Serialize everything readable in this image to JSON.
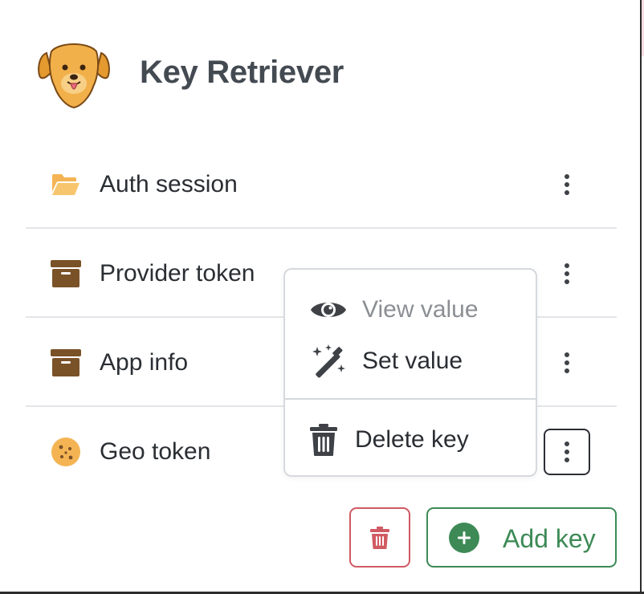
{
  "app": {
    "title": "Key Retriever",
    "logo_icon": "golden-retriever-logo"
  },
  "keys": [
    {
      "label": "Auth session",
      "icon": "folder-open-icon"
    },
    {
      "label": "Provider token",
      "icon": "archive-box-icon"
    },
    {
      "label": "App info",
      "icon": "archive-box-icon"
    },
    {
      "label": "Geo token",
      "icon": "cookie-icon"
    }
  ],
  "context_menu": {
    "view_value": "View value",
    "set_value": "Set value",
    "delete_key": "Delete key"
  },
  "actions": {
    "add_key": "Add key"
  },
  "colors": {
    "accent_green": "#3d8a56",
    "danger_red": "#d05a63",
    "folder_orange": "#f4b454",
    "archive_brown": "#7a5228",
    "cookie_orange": "#f4b454",
    "disabled_text": "#8b8f94"
  }
}
